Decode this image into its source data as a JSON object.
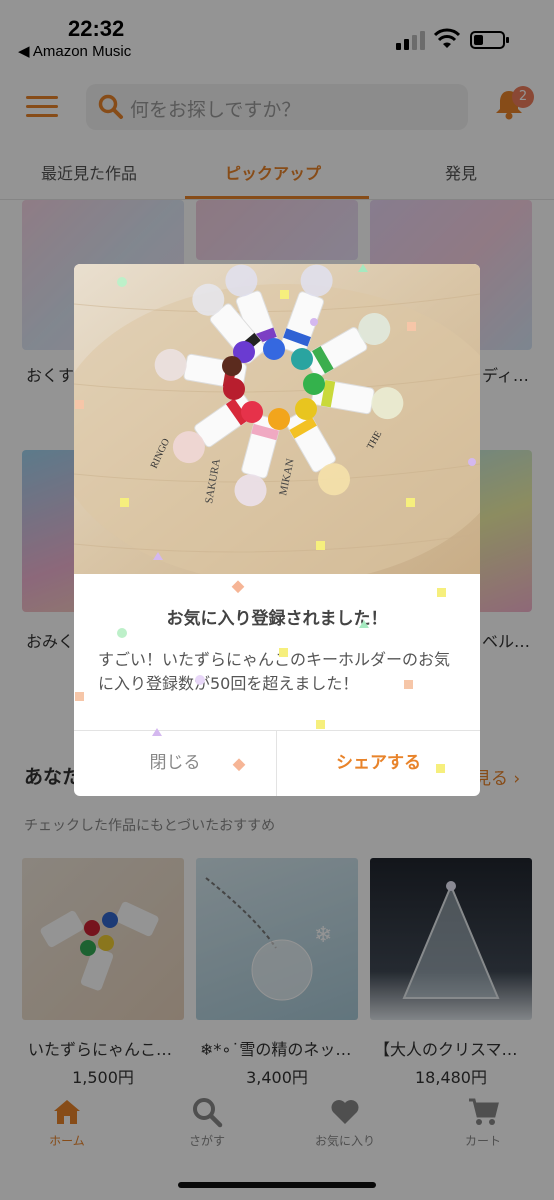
{
  "status_bar": {
    "time": "22:32",
    "back_app": "◀ Amazon Music"
  },
  "header": {
    "search_placeholder": "何をお探しですか？",
    "notification_count": "2"
  },
  "tabs": [
    {
      "label": "最近見た作品"
    },
    {
      "label": "ピックアップ",
      "active": true
    },
    {
      "label": "発見"
    }
  ],
  "background_cards": {
    "row1": [
      "おくす",
      "ディ…"
    ],
    "row2": [
      "おみく",
      "ベル…"
    ]
  },
  "recommend": {
    "title": "あなた",
    "see_more": "見る ›",
    "subtitle": "チェックした作品にもとづいたおすすめ",
    "items": [
      {
        "title": "いたずらにゃんこ…",
        "price": "1,500円"
      },
      {
        "title": "❄*∘˙雪の精のネッ…",
        "price": "3,400円"
      },
      {
        "title": "【大人のクリスマ…",
        "price": "18,480円"
      }
    ]
  },
  "bottom_nav": [
    {
      "label": "ホーム",
      "icon": "home-icon",
      "active": true
    },
    {
      "label": "さがす",
      "icon": "search-icon"
    },
    {
      "label": "お気に入り",
      "icon": "heart-icon"
    },
    {
      "label": "カート",
      "icon": "cart-icon"
    }
  ],
  "modal": {
    "title": "お気に入り登録されました！",
    "message": "すごい！いたずらにゃんこのキーホルダーのお気に入り登録数が50回を超えました！",
    "close_label": "閉じる",
    "share_label": "シェアする",
    "photo_labels": [
      "RINGO",
      "SAKURA",
      "MIKAN",
      "THE"
    ]
  },
  "colors": {
    "accent": "#e8832a",
    "badge": "#ee7d5c"
  }
}
